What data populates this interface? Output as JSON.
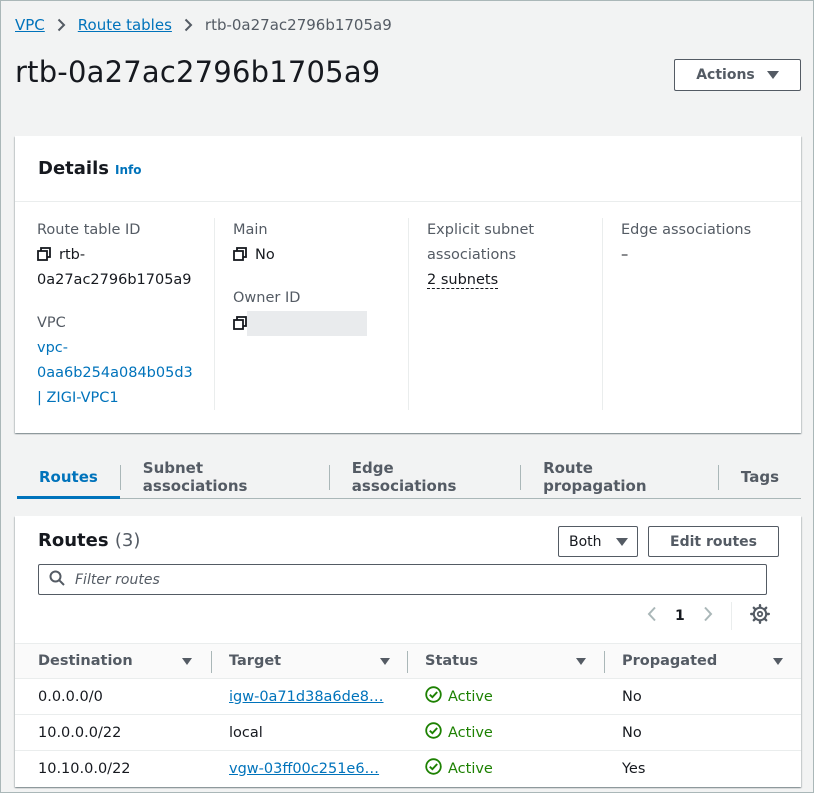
{
  "breadcrumb": {
    "items": [
      "VPC",
      "Route tables"
    ],
    "current": "rtb-0a27ac2796b1705a9"
  },
  "page": {
    "title": "rtb-0a27ac2796b1705a9",
    "actions_label": "Actions"
  },
  "details": {
    "title": "Details",
    "info_label": "Info",
    "route_table_id_label": "Route table ID",
    "route_table_id_line1": "rtb-",
    "route_table_id_line2": "0a27ac2796b1705a9",
    "vpc_label": "VPC",
    "vpc_line1": "vpc-",
    "vpc_line2": "0aa6b254a084b05d3",
    "vpc_line3": "| ZIGI-VPC1",
    "main_label": "Main",
    "main_value": "No",
    "owner_id_label": "Owner ID",
    "explicit_label_line1": "Explicit subnet",
    "explicit_label_line2": "associations",
    "explicit_value": "2 subnets",
    "edge_label": "Edge associations",
    "edge_value": "–"
  },
  "tabs": [
    {
      "label": "Routes",
      "active": true
    },
    {
      "label": "Subnet associations",
      "active": false
    },
    {
      "label": "Edge associations",
      "active": false
    },
    {
      "label": "Route propagation",
      "active": false
    },
    {
      "label": "Tags",
      "active": false
    }
  ],
  "routes": {
    "title": "Routes",
    "count": "(3)",
    "filter_select_value": "Both",
    "edit_label": "Edit routes",
    "filter_placeholder": "Filter routes",
    "page_number": "1",
    "columns": [
      "Destination",
      "Target",
      "Status",
      "Propagated"
    ],
    "rows": [
      {
        "destination": "0.0.0.0/0",
        "target": "igw-0a71d38a6de8…",
        "target_link": true,
        "status": "Active",
        "propagated": "No"
      },
      {
        "destination": "10.0.0.0/22",
        "target": "local",
        "target_link": false,
        "status": "Active",
        "propagated": "No"
      },
      {
        "destination": "10.10.0.0/22",
        "target": "vgw-03ff00c251e6…",
        "target_link": true,
        "status": "Active",
        "propagated": "Yes"
      }
    ]
  },
  "colors": {
    "link": "#0073bb",
    "success": "#1d8102",
    "text": "#16191f",
    "muted": "#545b64"
  }
}
